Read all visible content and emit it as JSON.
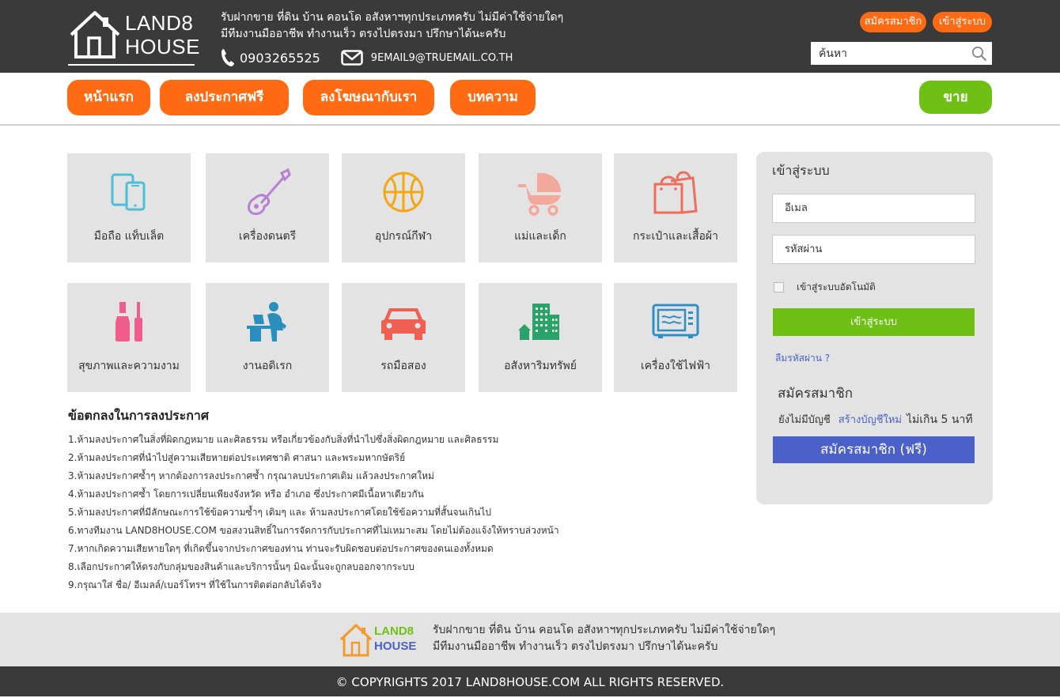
{
  "header": {
    "logo_line1": "LAND8",
    "logo_line2": "HOUSE",
    "tagline_line1": "รับฝากขาย ที่ดิน บ้าน คอนโด อสังหาฯทุกประเภทครับ ไม่มีค่าใช้จ่ายใดๆ",
    "tagline_line2": "มีทีมงานมืออาชีพ ทำงานเร็ว ตรงไปตรงมา ปรึกษาได้นะครับ",
    "phone": "0903265525",
    "email": "9EMAIL9@TRUEMAIL.CO.TH",
    "register_label": "สมัครสมาชิก",
    "login_label": "เข้าสู่ระบบ",
    "search_placeholder": "ค้นหา",
    "accent_color": "#ff6a12"
  },
  "nav": {
    "home": "หน้าแรก",
    "post_free": "ลงประกาศฟรี",
    "advertise": "ลงโฆษณากับเรา",
    "articles": "บทความ",
    "sell": "ขาย",
    "sell_color": "#6ec114"
  },
  "categories": [
    {
      "label": "มือถือ แท็บเล็ต",
      "icon": "mobile-tablet-icon"
    },
    {
      "label": "เครื่องดนตรี",
      "icon": "guitar-icon"
    },
    {
      "label": "อุปกรณ์กีฬา",
      "icon": "basketball-icon"
    },
    {
      "label": "แม่และเด็ก",
      "icon": "stroller-icon"
    },
    {
      "label": "กระเป๋าและเสื้อผ้า",
      "icon": "shopping-bag-icon"
    },
    {
      "label": "สุขภาพและความงาม",
      "icon": "cosmetics-icon"
    },
    {
      "label": "งานอดิเรก",
      "icon": "person-at-desk-icon"
    },
    {
      "label": "รถมือสอง",
      "icon": "car-icon"
    },
    {
      "label": "อสังหาริมทรัพย์",
      "icon": "buildings-icon"
    },
    {
      "label": "เครื่องใช้ไฟฟ้า",
      "icon": "microwave-icon"
    }
  ],
  "terms": {
    "title": "ข้อตกลงในการลงประกาศ",
    "items": [
      "1.ห้ามลงประกาศในสิ่งที่ผิดกฎหมาย   และศิลธรรม หรือเกี่ยวข้องกับสิ่งที่นำไปซึ่งสิ่งผิดกฎหมาย และศิลธรรม",
      "2.ห้ามลงประกาศที่นำไปสู่ความเสียหายต่อประเทศชาติ   ศาสนา และพระมหากษัตริย์",
      "3.ห้ามลงประกาศซ้ำๆ หากต้องการลงประกาศซ้ำ กรุณาลบประกาศเดิม แล้วลงประกาศใหม่",
      "4.ห้ามลงประกาศซ้ำ โดยการเปลี่ยนเพียงจังหวัด หรือ อำเภอ ซึ่งประกาศมีเนื้อหาเดียวกัน",
      "5.ห้ามลงประกาศที่มีลักษณะการใช้ข้อความซ้ำๆ เดิมๆ และ ห้ามลงประกาศโดยใช้ข้อความที่สั้นจนเกินไป",
      "6.ทางทีมงาน LAND8HOUSE.COM ขอสงวนสิทธิ์ในการจัดการกับประกาศที่ไม่เหมาะสม   โดยไม่ต้องแจ้งให้ทราบล่วงหน้า",
      "7.หากเกิดความเสียหายใดๆ ที่เกิดขึ้นจากประกาศของท่าน ท่านจะรับผิดชอบต่อประกาศของตนเองทั้งหมด",
      "8.เลือกประกาศให้ตรงกับกลุ่มของสินค้าและบริการนั้นๆ มิฉะนั้นจะถูกลบออกจากระบบ",
      "9.กรุณาใส่ ชื่อ/ อีเมลล์/เบอร์โทรฯ ที่ใช้ในการติดต่อกลับได้จริง"
    ]
  },
  "login": {
    "title": "เข้าสู่ระบบ",
    "email_placeholder": "อีเมล",
    "password_placeholder": "รหัสผ่าน",
    "remember_label": "เข้าสู่ระบบอัตโนมัติ",
    "submit_label": "เข้าสู่ระบบ",
    "forgot_label": "ลืมรหัสผ่าน ?",
    "register_title": "สมัครสมาชิก",
    "no_account_text": "ยังไม่มีบัญชี",
    "create_account_link": "สร้างบัญชีใหม่",
    "time_text": "ไม่เกิน 5 นาที",
    "register_button": "สมัครสมาชิก (ฟรี)",
    "register_color": "#4b60c9"
  },
  "footer": {
    "logo_line1": "LAND8",
    "logo_line2": "HOUSE",
    "tagline_line1": "รับฝากขาย ที่ดิน บ้าน คอนโด อสังหาฯทุกประเภทครับ ไม่มีค่าใช้จ่ายใดๆ",
    "tagline_line2": "มีทีมงานมืออาชีพ ทำงานเร็ว ตรงไปตรงมา ปรึกษาได้นะครับ",
    "copyright": "©  COPYRIGHTS  2017  LAND8HOUSE.COM  ALL  RIGHTS  RESERVED."
  }
}
